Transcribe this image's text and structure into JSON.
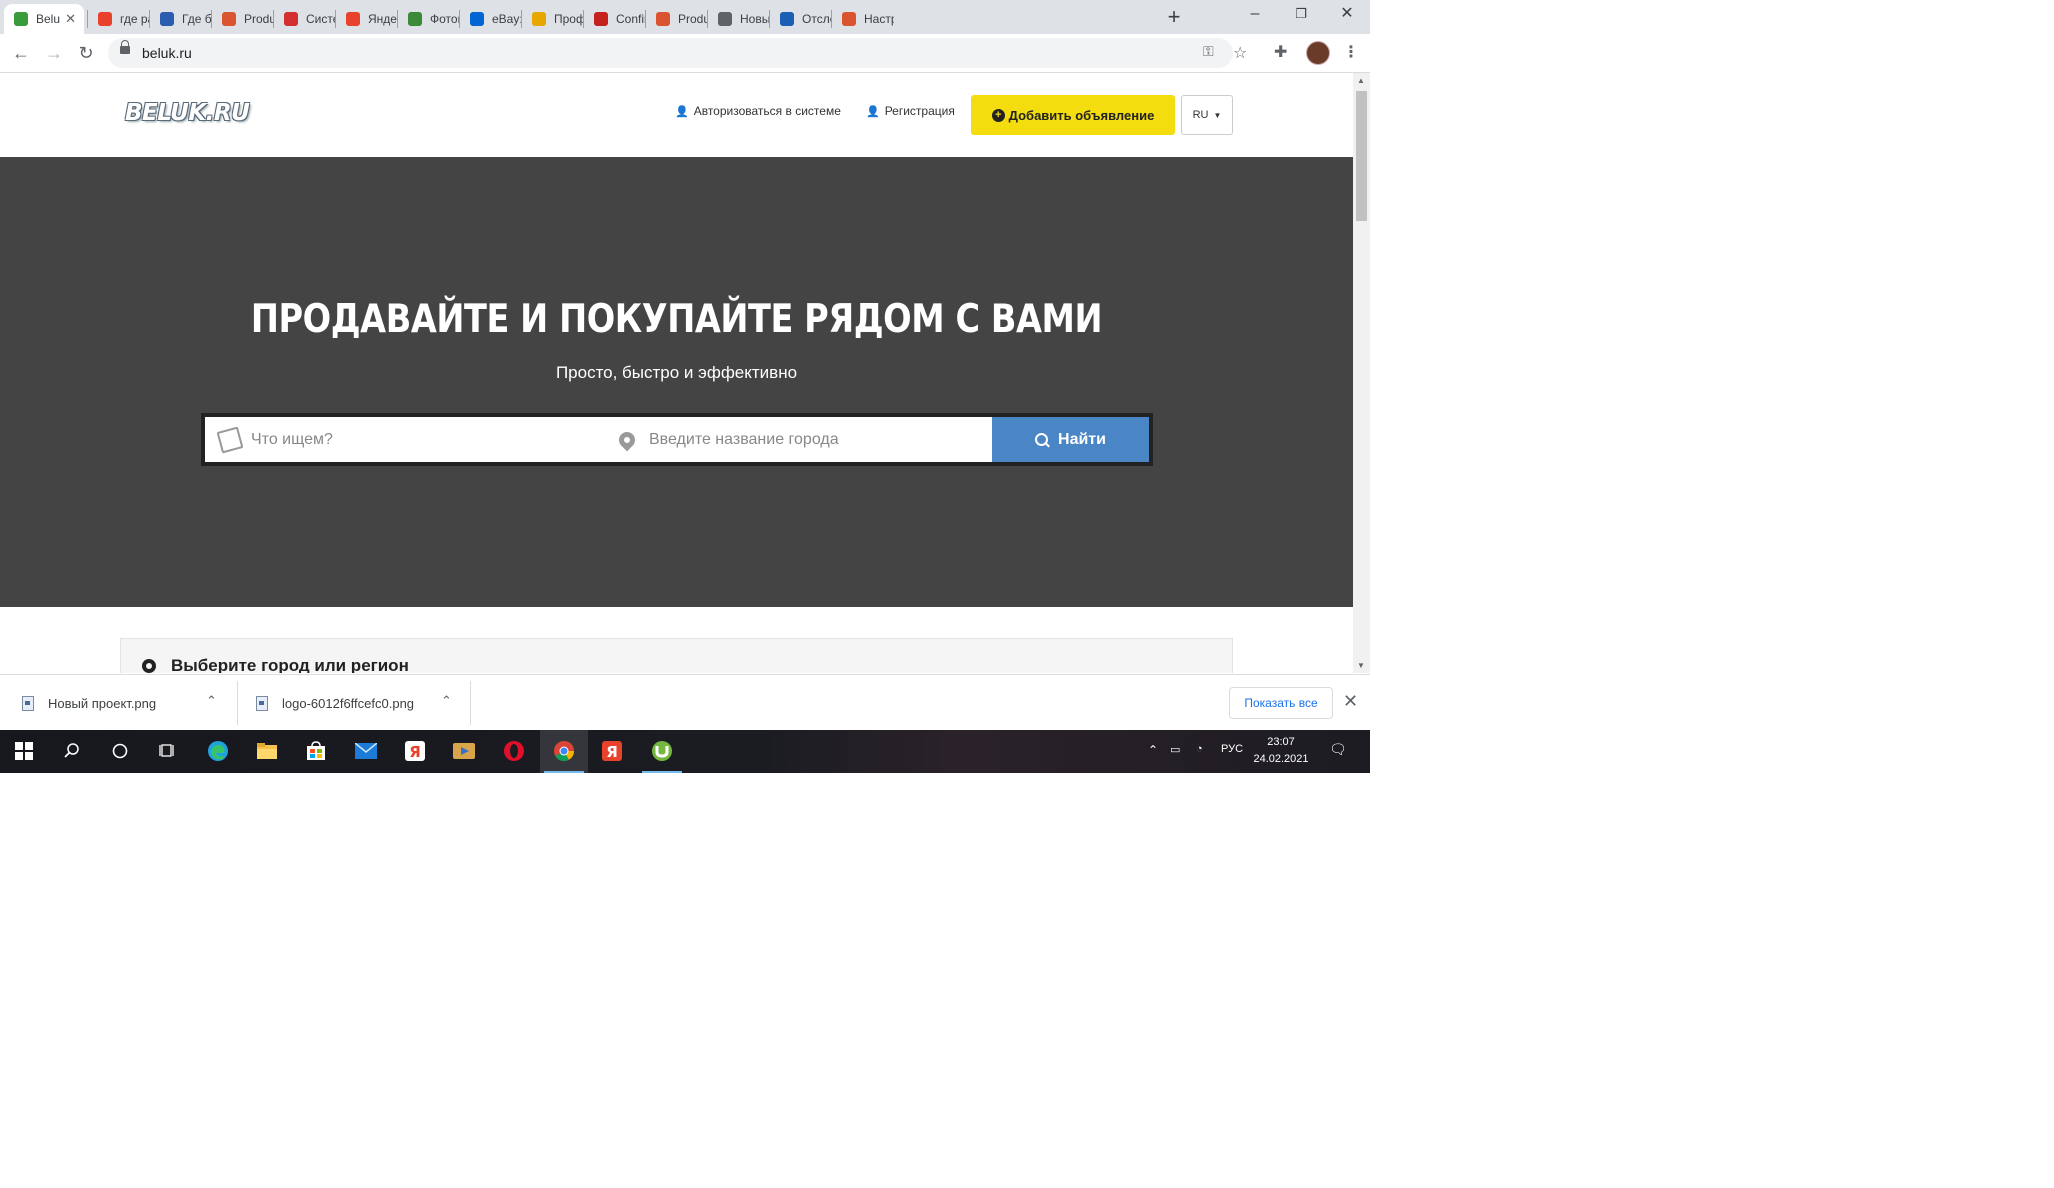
{
  "browser": {
    "tabs": [
      {
        "title": "Belu",
        "favicon_color": "#3a9b3a",
        "favicon_glyph": "leaf-icon",
        "active": true
      },
      {
        "title": "где ра:",
        "favicon_color": "#e8412c",
        "favicon_glyph": "yandex-icon"
      },
      {
        "title": "Где бе:",
        "favicon_color": "#2a5db0",
        "favicon_glyph": "site-icon"
      },
      {
        "title": "Product",
        "favicon_color": "#da552f",
        "favicon_glyph": "producthunt-icon"
      },
      {
        "title": "Систем",
        "favicon_color": "#d32f2f",
        "favicon_glyph": "fis-icon"
      },
      {
        "title": "Яндекс",
        "favicon_color": "#e8412c",
        "favicon_glyph": "yandex-icon"
      },
      {
        "title": "Фотош",
        "favicon_color": "#3a8a3a",
        "favicon_glyph": "photoshop-icon"
      },
      {
        "title": "eBay: С",
        "favicon_color": "#0064d2",
        "favicon_glyph": "ebay-icon"
      },
      {
        "title": "Профи",
        "favicon_color": "#e6a800",
        "favicon_glyph": "bag-icon"
      },
      {
        "title": "Confirm",
        "favicon_color": "#c5221f",
        "favicon_glyph": "gmail-icon"
      },
      {
        "title": "Product",
        "favicon_color": "#da552f",
        "favicon_glyph": "producthunt-icon"
      },
      {
        "title": "Новый",
        "favicon_color": "#5f6368",
        "favicon_glyph": "globe-icon"
      },
      {
        "title": "Отслеж",
        "favicon_color": "#1a5fb4",
        "favicon_glyph": "emblem-icon"
      },
      {
        "title": "Настро",
        "favicon_color": "#da552f",
        "favicon_glyph": "producthunt-icon"
      }
    ],
    "new_tab_label": "+",
    "url": "beluk.ru"
  },
  "site": {
    "logo": "BELUK.RU",
    "login_label": "Авторизоваться в системе",
    "register_label": "Регистрация",
    "add_ad_label": "Добавить объявление",
    "lang_label": "RU",
    "hero_title": "ПРОДАВАЙТЕ И ПОКУПАЙТЕ РЯДОМ С ВАМИ",
    "hero_subtitle": "Просто, быстро и эффективно",
    "search_placeholder": "Что ищем?",
    "city_placeholder": "Введите название города",
    "find_label": "Найти",
    "region_title": "Выберите город или регион"
  },
  "downloads": {
    "items": [
      {
        "name": "Новый проект.png"
      },
      {
        "name": "logo-6012f6ffcefc0.png"
      }
    ],
    "show_all_label": "Показать все"
  },
  "taskbar": {
    "apps": [
      "windows-start-icon",
      "search-icon",
      "cortana-icon",
      "task-view-icon",
      "edge-icon",
      "file-explorer-icon",
      "store-icon",
      "mail-icon",
      "yandex-browser-icon",
      "media-player-icon",
      "opera-icon",
      "chrome-icon",
      "yandex-icon",
      "utorrent-icon"
    ],
    "lang": "РУС",
    "time": "23:07",
    "date": "24.02.2021"
  },
  "colors": {
    "accent_yellow": "#f4dd0e",
    "find_blue": "#4a86c5",
    "hero_bg": "#444444"
  }
}
